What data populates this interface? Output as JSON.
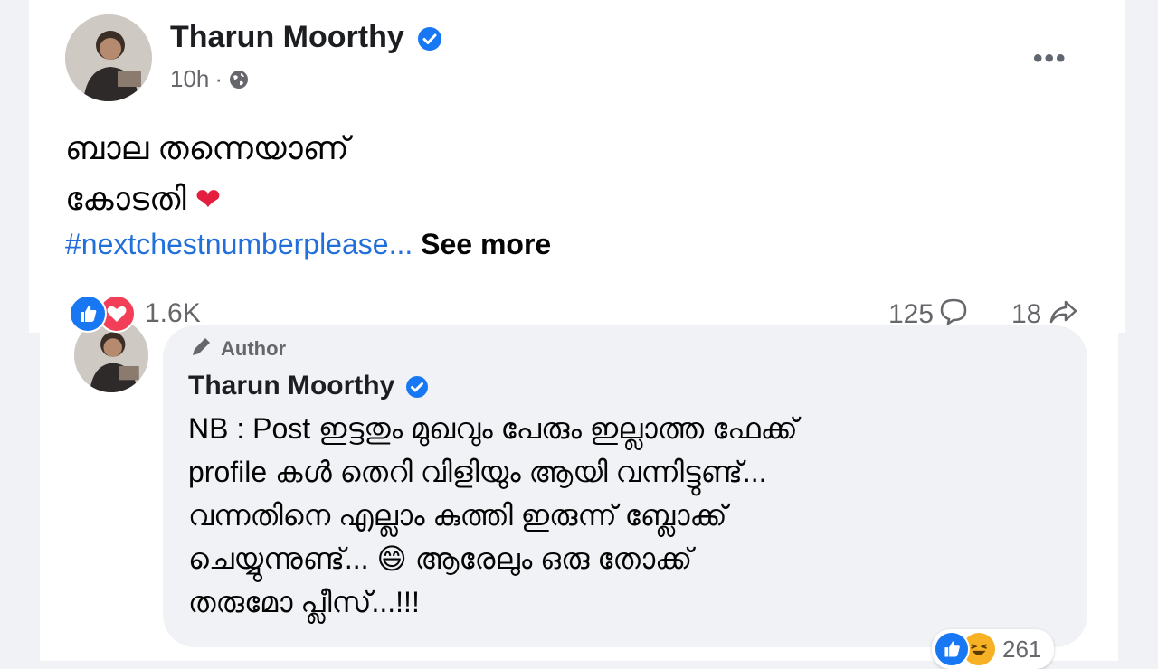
{
  "post": {
    "author": "Tharun Moorthy",
    "time": "10h",
    "text_line1": "ബാല തന്നെയാണ്",
    "text_line2": "കോടതി",
    "hashtag": "#nextchestnumberplease...",
    "see_more": "See more",
    "reaction_count": "1.6K",
    "comment_count": "125",
    "share_count": "18"
  },
  "comment": {
    "badge": "Author",
    "author": "Tharun Moorthy",
    "text_line1": "NB : Post ഇട്ടതും മുഖവും പേരും ഇല്ലാത്ത ഫേക്ക്",
    "text_line2": "profile കൾ തെറി വിളിയും ആയി വന്നിട്ടുണ്ട്...",
    "text_line3": "വന്നതിനെ എല്ലാം കുത്തി ഇരുന്ന് ബ്ലോക്ക്",
    "text_line4_a": "ചെയ്യുന്നുണ്ട്...",
    "text_line4_b": "ആരേലും ഒരു തോക്ക്",
    "text_line5": "തരുമോ പ്ലീസ്...!!!",
    "reaction_count": "261"
  },
  "icons": {
    "verified": "verified-badge-icon",
    "globe": "globe-icon",
    "more": "more-options-icon",
    "like": "like-reaction-icon",
    "love": "love-reaction-icon",
    "haha": "haha-reaction-icon",
    "comment": "comment-icon",
    "share": "share-icon",
    "pen": "author-pen-icon"
  },
  "colors": {
    "link_blue": "#216fdb",
    "verified_blue": "#1877f2",
    "heart_red": "#e41e3f",
    "meta_gray": "#65676b",
    "bubble_bg": "#f0f2f5"
  }
}
